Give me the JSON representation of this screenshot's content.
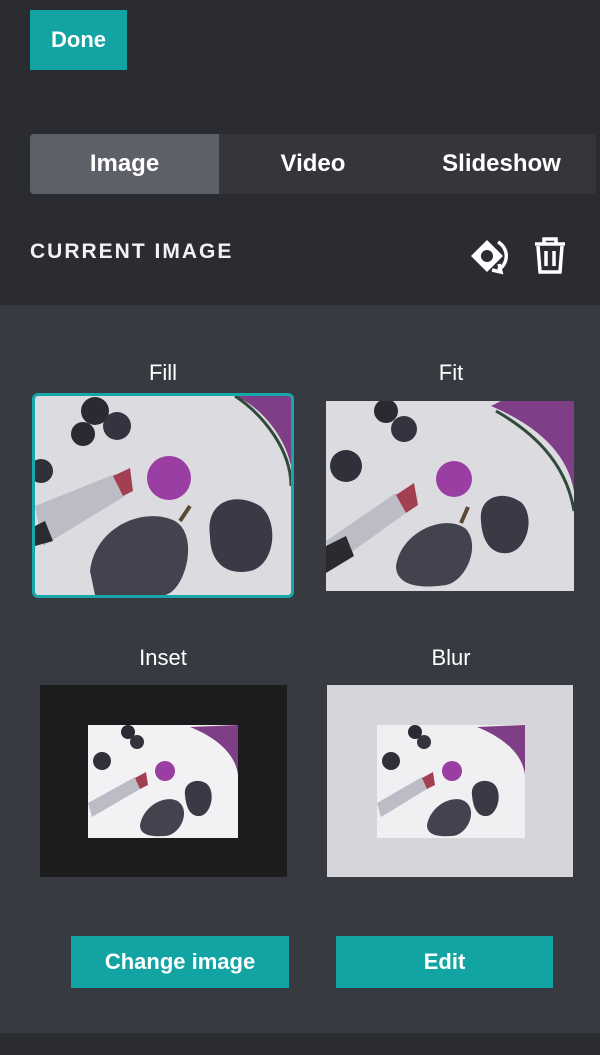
{
  "header": {
    "done_label": "Done"
  },
  "tabs": [
    {
      "label": "Image",
      "active": true
    },
    {
      "label": "Video",
      "active": false
    },
    {
      "label": "Slideshow",
      "active": false
    }
  ],
  "current_image": {
    "title": "CURRENT IMAGE",
    "replace_icon": "replace-icon",
    "delete_icon": "trash-icon"
  },
  "options": [
    {
      "label": "Fill",
      "selected": true
    },
    {
      "label": "Fit",
      "selected": false
    },
    {
      "label": "Inset",
      "selected": false
    },
    {
      "label": "Blur",
      "selected": false
    }
  ],
  "actions": {
    "change_label": "Change image",
    "edit_label": "Edit"
  },
  "colors": {
    "accent": "#12a3a3",
    "panel_dark": "#2b2c31",
    "panel_light": "#383a42",
    "tab_active": "#5e6067"
  }
}
